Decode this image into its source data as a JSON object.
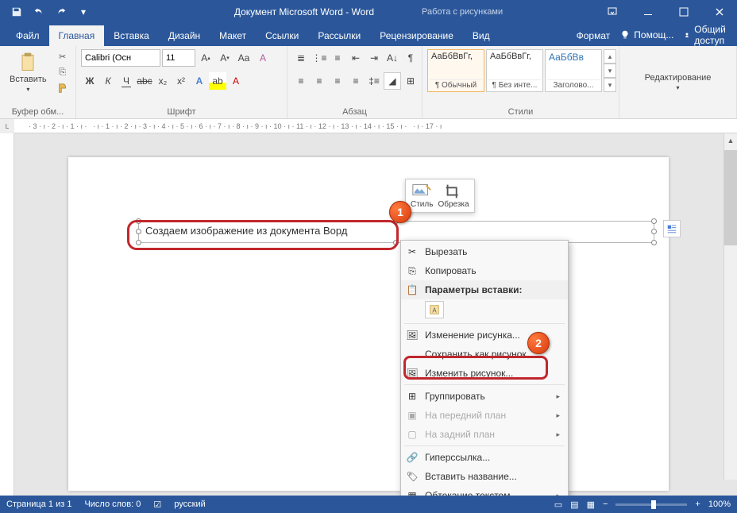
{
  "window": {
    "title": "Документ Microsoft Word - Word",
    "context_tab_title": "Работа с рисунками"
  },
  "tabs": {
    "file": "Файл",
    "home": "Главная",
    "insert": "Вставка",
    "design": "Дизайн",
    "layout": "Макет",
    "references": "Ссылки",
    "mailings": "Рассылки",
    "review": "Рецензирование",
    "view": "Вид",
    "format": "Формат",
    "help": "Помощ...",
    "share": "Общий доступ"
  },
  "ribbon": {
    "clipboard": {
      "label": "Буфер обм...",
      "paste": "Вставить"
    },
    "font": {
      "label": "Шрифт",
      "name": "Calibri (Осн",
      "size": "11",
      "bold": "Ж",
      "italic": "К",
      "underline": "Ч",
      "strike": "abc",
      "sub": "x₂",
      "sup": "x²",
      "fontcolor": "A",
      "case": "Aa",
      "clear": "A"
    },
    "paragraph": {
      "label": "Абзац"
    },
    "styles": {
      "label": "Стили",
      "items": [
        {
          "sample": "АаБбВвГг,",
          "name": "¶ Обычный"
        },
        {
          "sample": "АаБбВвГг,",
          "name": "¶ Без инте..."
        },
        {
          "sample": "АаБбВв",
          "name": "Заголово..."
        }
      ]
    },
    "editing": {
      "label": "Редактирование"
    }
  },
  "ruler": "· 3 · ı · 2 · ı · 1 · ı ·   · ı · 1 · ı · 2 · ı · 3 · ı · 4 · ı · 5 · ı · 6 · ı · 7 · ı · 8 · ı · 9 · ı · 10 · ı · 11 · ı · 12 · ı · 13 · ı · 14 · ı · 15 · ı ·   · ı · 17 · ı",
  "document": {
    "object_text": "Создаем изображение из документа Ворд"
  },
  "mini_toolbar": {
    "style": "Стиль",
    "crop": "Обрезка"
  },
  "context_menu": {
    "cut": "Вырезать",
    "copy": "Копировать",
    "paste_options": "Параметры вставки:",
    "change_picture": "Изменение рисунка...",
    "save_as_picture": "Сохранить как рисунок...",
    "edit_picture": "Изменить рисунок...",
    "group": "Группировать",
    "bring_front": "На передний план",
    "send_back": "На задний план",
    "hyperlink": "Гиперссылка...",
    "insert_caption": "Вставить название...",
    "text_wrap": "Обтекание текстом"
  },
  "statusbar": {
    "page": "Страница 1 из 1",
    "words": "Число слов: 0",
    "lang": "русский",
    "zoom": "100%"
  },
  "callouts": {
    "b1": "1",
    "b2": "2"
  }
}
